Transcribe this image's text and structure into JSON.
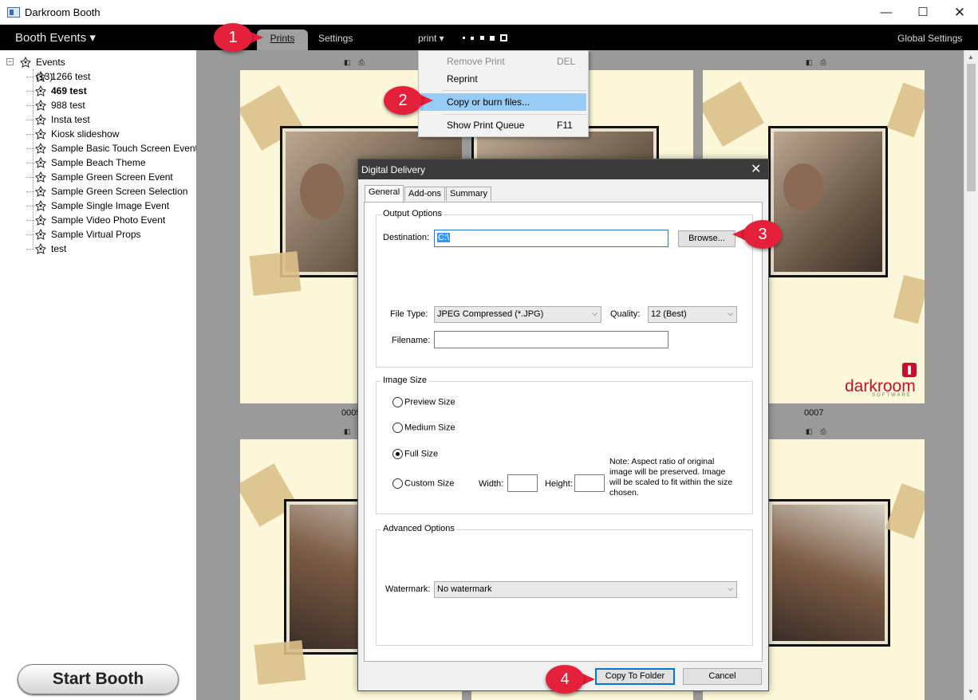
{
  "window": {
    "title": "Darkroom Booth",
    "minimize_glyph": "—",
    "maximize_glyph": "☐",
    "close_glyph": "✕"
  },
  "menubar": {
    "booth_events": "Booth Events ▾",
    "tab_prints": "Prints",
    "tab_settings": "Settings",
    "print_menu": "print ▾",
    "global_settings": "Global Settings"
  },
  "sidebar": {
    "root_label": "Events (13)",
    "expander": "−",
    "items": [
      {
        "label": "1266 test",
        "bold": false
      },
      {
        "label": "469 test",
        "bold": true
      },
      {
        "label": "988 test",
        "bold": false
      },
      {
        "label": "Insta test",
        "bold": false
      },
      {
        "label": "Kiosk slideshow",
        "bold": false
      },
      {
        "label": "Sample Basic Touch Screen Event",
        "bold": false
      },
      {
        "label": "Sample Beach Theme",
        "bold": false
      },
      {
        "label": "Sample Green Screen Event",
        "bold": false
      },
      {
        "label": "Sample Green Screen Selection",
        "bold": false
      },
      {
        "label": "Sample Single Image Event",
        "bold": false
      },
      {
        "label": "Sample Video Photo Event",
        "bold": false
      },
      {
        "label": "Sample Virtual Props",
        "bold": false
      },
      {
        "label": "test",
        "bold": false
      }
    ],
    "start_booth": "Start Booth"
  },
  "gallery": {
    "thumb_icon_a": "◧",
    "thumb_icon_b": "⎙",
    "labels": [
      "0005",
      "0007"
    ],
    "logo_word": "darkroom",
    "logo_sub": "SOFTWARE"
  },
  "print_menu": {
    "items": [
      {
        "label": "Remove Print",
        "shortcut": "DEL",
        "disabled": true
      },
      {
        "label": "Reprint",
        "shortcut": "",
        "disabled": false
      },
      {
        "label": "Copy or burn files...",
        "shortcut": "",
        "disabled": false,
        "highlighted": true
      },
      {
        "label": "Show Print Queue",
        "shortcut": "F11",
        "disabled": false
      }
    ]
  },
  "dialog": {
    "title": "Digital Delivery",
    "close_glyph": "✕",
    "tabs": [
      "General",
      "Add-ons",
      "Summary"
    ],
    "output_options": {
      "legend": "Output Options",
      "destination_label": "Destination:",
      "destination_value": "C:\\",
      "browse_button": "Browse...",
      "file_type_label": "File Type:",
      "file_type_value": "JPEG Compressed (*.JPG)",
      "quality_label": "Quality:",
      "quality_value": "12 (Best)",
      "filename_label": "Filename:",
      "filename_value": ""
    },
    "image_size": {
      "legend": "Image Size",
      "preview": "Preview Size",
      "medium": "Medium Size",
      "full": "Full Size",
      "custom": "Custom Size",
      "selected": "Full Size",
      "width_label": "Width:",
      "height_label": "Height:",
      "note": "Note: Aspect ratio of original image will be preserved. Image will be scaled to fit within the size chosen."
    },
    "advanced": {
      "legend": "Advanced Options",
      "watermark_label": "Watermark:",
      "watermark_value": "No watermark"
    },
    "copy_button": "Copy To Folder",
    "cancel_button": "Cancel"
  },
  "callouts": [
    "1",
    "2",
    "3",
    "4"
  ],
  "colors": {
    "callout": "#e5203a",
    "menu_highlight": "#99ccf5",
    "brand_red": "#c8102e",
    "focus_blue": "#0078d7"
  }
}
